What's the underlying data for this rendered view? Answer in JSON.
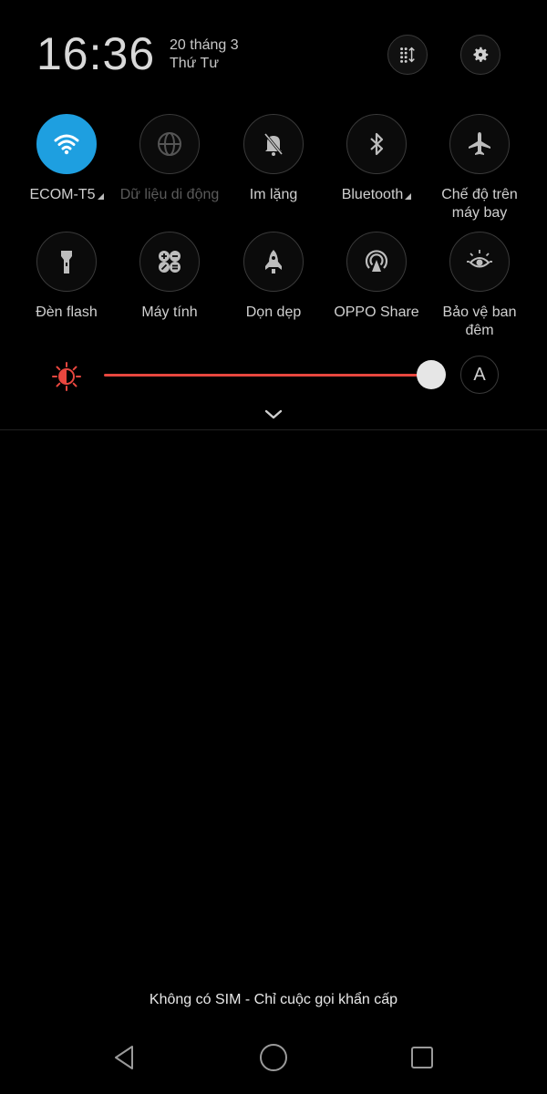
{
  "header": {
    "time": "16:36",
    "date": "20 tháng 3",
    "weekday": "Thứ Tư",
    "edit_icon": "grid-sort-icon",
    "settings_icon": "gear-icon"
  },
  "tiles": [
    {
      "label": "ECOM-T5",
      "icon": "wifi-icon",
      "active": true,
      "has_arrow": true
    },
    {
      "label": "Dữ liệu di động",
      "icon": "globe-icon",
      "active": false,
      "disabled": true
    },
    {
      "label": "Im lặng",
      "icon": "bell-off-icon",
      "active": false
    },
    {
      "label": "Bluetooth",
      "icon": "bluetooth-icon",
      "active": false,
      "has_arrow": true
    },
    {
      "label": "Chế độ trên máy bay",
      "icon": "airplane-icon",
      "active": false
    },
    {
      "label": "Đèn flash",
      "icon": "flashlight-icon",
      "active": false
    },
    {
      "label": "Máy tính",
      "icon": "calculator-icon",
      "active": false
    },
    {
      "label": "Dọn dẹp",
      "icon": "rocket-icon",
      "active": false
    },
    {
      "label": "OPPO Share",
      "icon": "share-radar-icon",
      "active": false
    },
    {
      "label": "Bảo vệ ban đêm",
      "icon": "eye-sun-icon",
      "active": false
    }
  ],
  "brightness": {
    "level_percent": 100,
    "auto_label": "A",
    "accent_color": "#e8473f"
  },
  "colors": {
    "active_tile": "#1e9fe0"
  },
  "status_message": "Không có SIM - Chỉ cuộc gọi khẩn cấp",
  "nav": {
    "back_icon": "back-triangle-icon",
    "home_icon": "home-circle-icon",
    "recents_icon": "recents-square-icon"
  }
}
